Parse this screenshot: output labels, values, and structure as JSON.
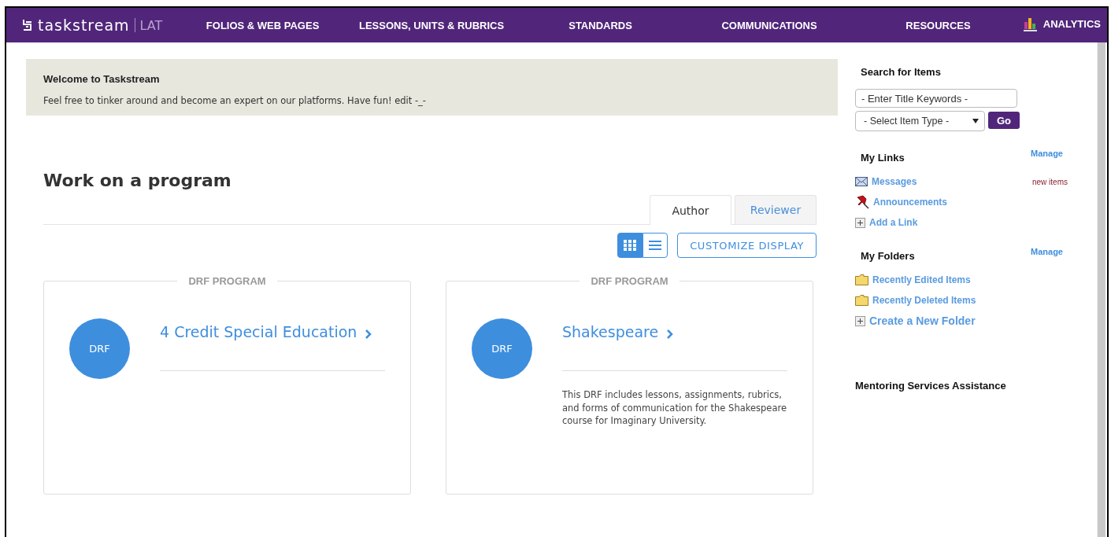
{
  "nav": {
    "logo": "taskstream",
    "product": "LAT",
    "items": [
      {
        "label": "FOLIOS & WEB PAGES"
      },
      {
        "label": "LESSONS, UNITS & RUBRICS"
      },
      {
        "label": "STANDARDS"
      },
      {
        "label": "COMMUNICATIONS"
      },
      {
        "label": "RESOURCES"
      },
      {
        "label": "ANALYTICS",
        "kind": "icon"
      }
    ]
  },
  "welcome": {
    "title": "Welcome to Taskstream",
    "text": "Feel free to tinker around and become an expert on our platforms. Have fun! edit -_-"
  },
  "heading": "Work on a program",
  "tabs": [
    {
      "label": "Author",
      "selected": true
    },
    {
      "label": "Reviewer",
      "selected": false
    }
  ],
  "views": [
    {
      "kind": "grid",
      "selected": true
    },
    {
      "kind": "list",
      "selected": false
    }
  ],
  "customize_button": "CUSTOMIZE DISPLAY",
  "programs": [
    {
      "type": "DRF PROGRAM",
      "badge": "DRF",
      "title": "4 Credit Special Education"
    },
    {
      "type": "DRF PROGRAM",
      "badge": "DRF",
      "title": "Shakespeare",
      "description": "This DRF includes lessons, assignments, rubrics, and forms of communication for the Shakespeare course for Imaginary University."
    }
  ],
  "sidebar": {
    "search_title": "Search for Items",
    "keyword_placeholder": "- Enter Title Keywords -",
    "type_select": "- Select Item Type -",
    "go": "Go",
    "links_title": "My Links",
    "links_manage": "Manage",
    "links": [
      {
        "label": "Messages",
        "kind": "envelope",
        "note": "new items"
      },
      {
        "label": "Announcements",
        "kind": "pin"
      },
      {
        "label": "Add a Link",
        "kind": "add"
      }
    ],
    "folders_title": "My Folders",
    "folders_manage": "Manage",
    "folders": [
      {
        "label": "Recently Edited Items",
        "kind": "folder"
      },
      {
        "label": "Recently Deleted Items",
        "kind": "folder"
      },
      {
        "label": "Create a New Folder",
        "kind": "add"
      }
    ],
    "mentoring": "Mentoring Services Assistance"
  }
}
